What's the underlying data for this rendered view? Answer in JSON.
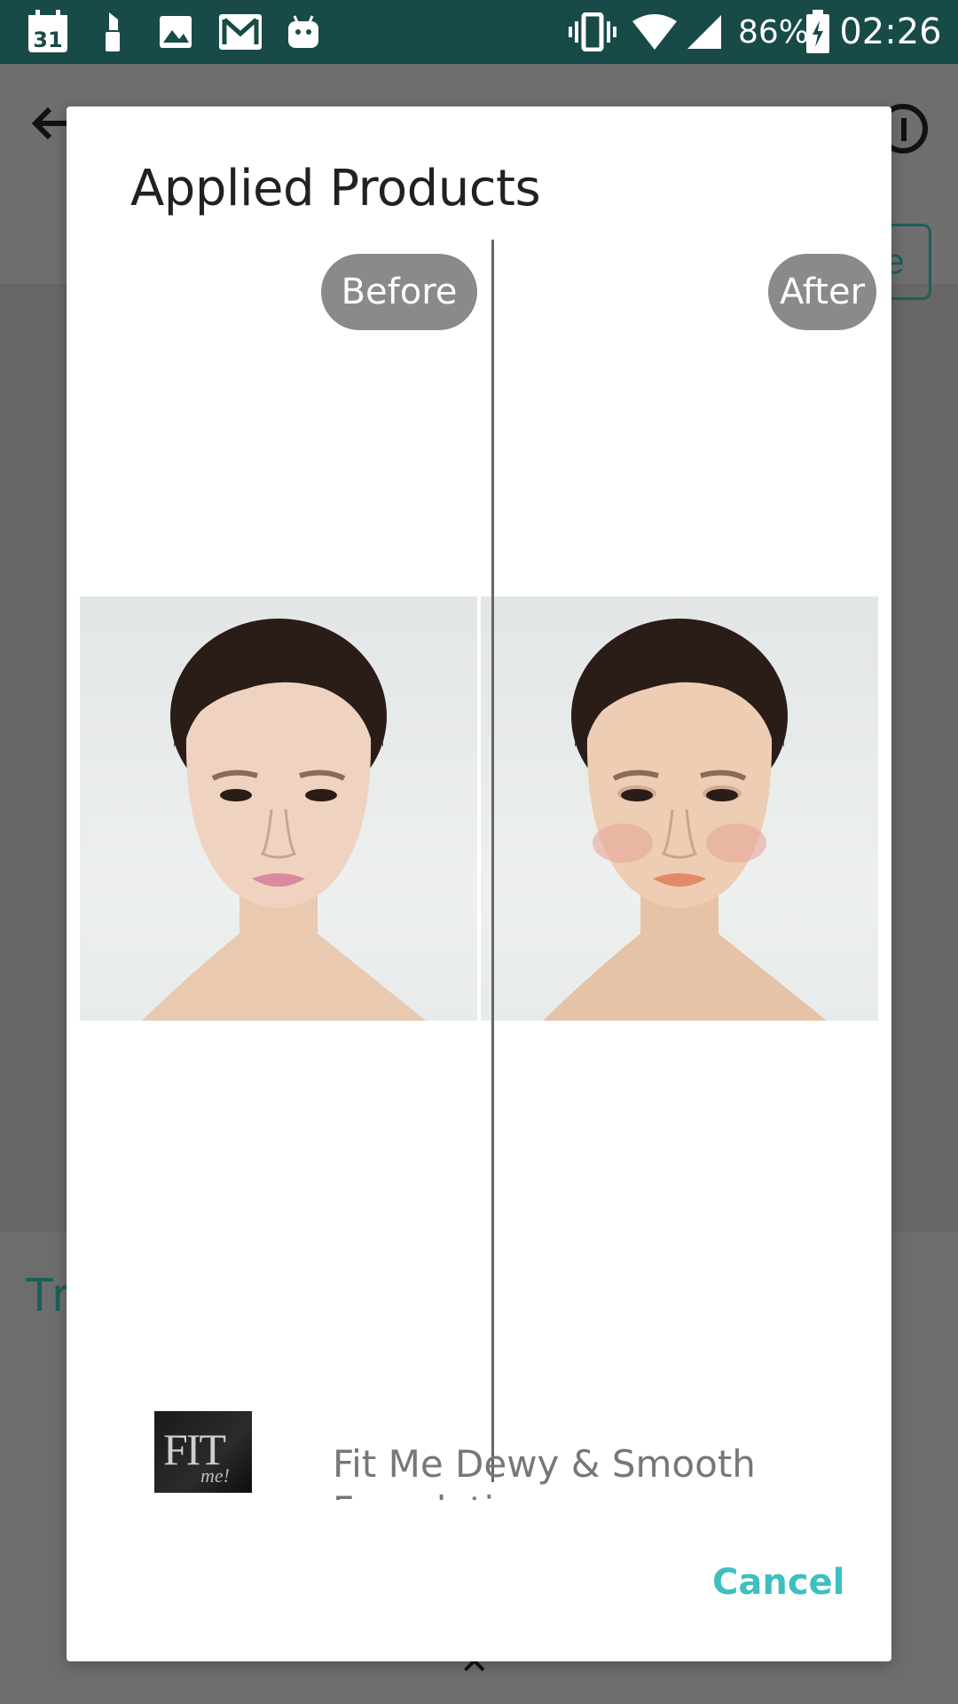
{
  "status_bar": {
    "calendar_day": "31",
    "battery": "86%",
    "time": "02:26",
    "icons": [
      "calendar-icon",
      "lipstick-icon",
      "image-icon",
      "gmail-icon",
      "android-icon",
      "vibrate-icon",
      "wifi-icon",
      "signal-icon",
      "battery-charging-icon"
    ]
  },
  "background": {
    "partial_heading": "Tr",
    "partial_button": "re"
  },
  "dialog": {
    "title": "Applied Products",
    "before_label": "Before",
    "after_label": "After",
    "product": {
      "thumb_text": "FIT",
      "thumb_subtext": "me!",
      "name": "Fit Me Dewy & Smooth Foundation"
    },
    "cancel_label": "Cancel"
  },
  "colors": {
    "status_bar": "#184a48",
    "accent": "#3fbfbf",
    "pill": "#8a8a8a",
    "scrim": "#6b6b6b"
  }
}
